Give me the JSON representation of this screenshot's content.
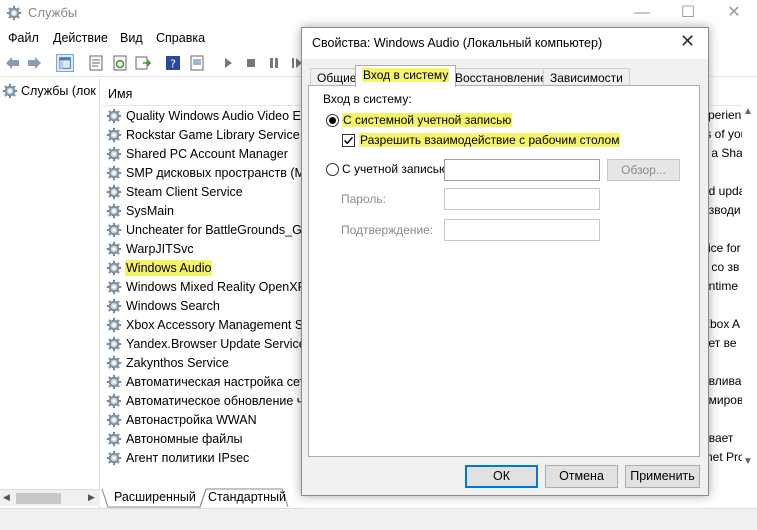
{
  "window": {
    "title": "Службы"
  },
  "menu": [
    "Файл",
    "Действие",
    "Вид",
    "Справка"
  ],
  "left_pane": {
    "item": "Службы (лок"
  },
  "list": {
    "column_name": "Имя",
    "rows": [
      "Quality Windows Audio Video Exp",
      "Rockstar Game Library Service",
      "Shared PC Account Manager",
      "SMP дисковых пространств (Ма",
      "Steam Client Service",
      "SysMain",
      "Uncheater for BattleGrounds_GL",
      "WarpJITSvc",
      "Windows Audio",
      "Windows Mixed Reality OpenXR S",
      "Windows Search",
      "Xbox Accessory Management Ser",
      "Yandex.Browser Update Service",
      "Zakynthos Service",
      "Автоматическая настройка сете",
      "Автоматическое обновление ча",
      "Автонастройка WWAN",
      "Автономные файлы",
      "Агент политики IPsec"
    ],
    "highlighted_row": "Windows Audio",
    "right_fragments": [
      "xperien",
      "ts of you",
      "s a Sha",
      "",
      "nd upda",
      "изводи",
      "",
      "vice for",
      "s со зв",
      "untime",
      "",
      "Xbox A",
      "яет ве",
      "",
      "авливае",
      "рмирова",
      "",
      "ивает",
      "rnet Pro"
    ]
  },
  "bottom_tabs": [
    "Расширенный",
    "Стандартный"
  ],
  "dialog": {
    "title": "Свойства: Windows Audio (Локальный компьютер)",
    "tabs": [
      "Общие",
      "Вход в систему",
      "Восстановление",
      "Зависимости"
    ],
    "active_tab": "Вход в систему",
    "group_label": "Вход в систему:",
    "radio_system": "С системной учетной записью",
    "checkbox_desktop": "Разрешить взаимодействие с рабочим столом",
    "radio_account": "С учетной записью:",
    "browse_label": "Обзор...",
    "password_label": "Пароль:",
    "confirm_label": "Подтверждение:",
    "buttons": {
      "ok": "ОК",
      "cancel": "Отмена",
      "apply": "Применить"
    }
  },
  "colors": {
    "highlight": "#f4f46a",
    "default_button_border": "#0078d7",
    "dialog_bg": "#f0f0f0"
  }
}
